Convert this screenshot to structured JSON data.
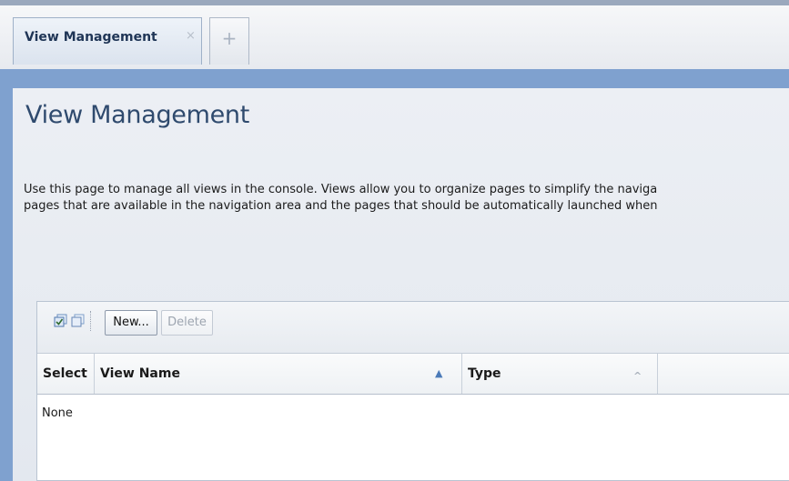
{
  "tabs": {
    "active": {
      "label": "View Management",
      "close": "×"
    },
    "add": "+"
  },
  "page": {
    "title": "View Management",
    "description_line1": "Use this page to manage all views in the console. Views allow you to organize pages to simplify the naviga",
    "description_line2": "pages that are available in the navigation area and the pages that should be automatically launched when"
  },
  "toolbar": {
    "select_all_icon": "select-all-icon",
    "deselect_all_icon": "deselect-all-icon",
    "new_label": "New...",
    "delete_label": "Delete"
  },
  "table": {
    "columns": [
      "Select",
      "View Name",
      "Type"
    ],
    "sort": {
      "view_name": "▲",
      "type": "^"
    },
    "empty_text": "None"
  }
}
